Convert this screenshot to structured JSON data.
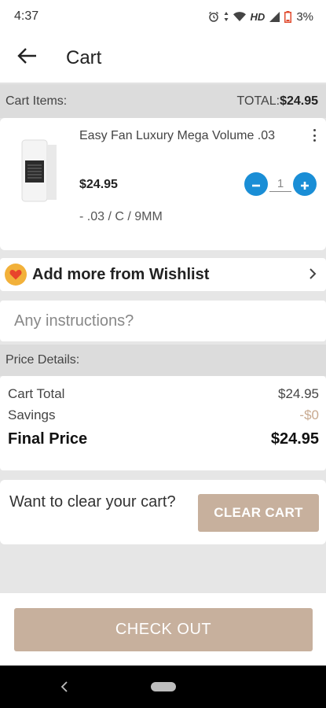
{
  "status_bar": {
    "time": "4:37",
    "network_label": "HD",
    "battery_text": "3%",
    "icons": [
      "alarm-icon",
      "data-arrows-icon",
      "wifi-icon",
      "signal-icon",
      "battery-low-icon"
    ]
  },
  "app_bar": {
    "back_icon": "arrow-left-icon",
    "title": "Cart"
  },
  "cart_header": {
    "label": "Cart Items:",
    "total_label": "TOTAL:",
    "total_value": "$24.95"
  },
  "cart_items": [
    {
      "name": "Easy Fan Luxury Mega Volume .03",
      "price": "$24.95",
      "quantity": "1",
      "variant": "- .03 / C / 9MM",
      "image_icon": "lash-product-image"
    }
  ],
  "wishlist": {
    "icon": "heart-icon",
    "label": "Add more from Wishlist"
  },
  "instructions": {
    "placeholder": "Any instructions?"
  },
  "price_details": {
    "header": "Price Details:",
    "cart_total_label": "Cart Total",
    "cart_total_value": "$24.95",
    "savings_label": "Savings",
    "savings_value": "-$0",
    "final_label": "Final Price",
    "final_value": "$24.95"
  },
  "clear_cart": {
    "prompt": "Want to clear your cart?",
    "button": "CLEAR CART"
  },
  "checkout": {
    "button": "CHECK OUT"
  },
  "colors": {
    "accent_blue": "#1a8ed6",
    "button_tan": "#c7b09d",
    "badge_orange": "#f2b13a",
    "heart_red": "#e8452c"
  }
}
